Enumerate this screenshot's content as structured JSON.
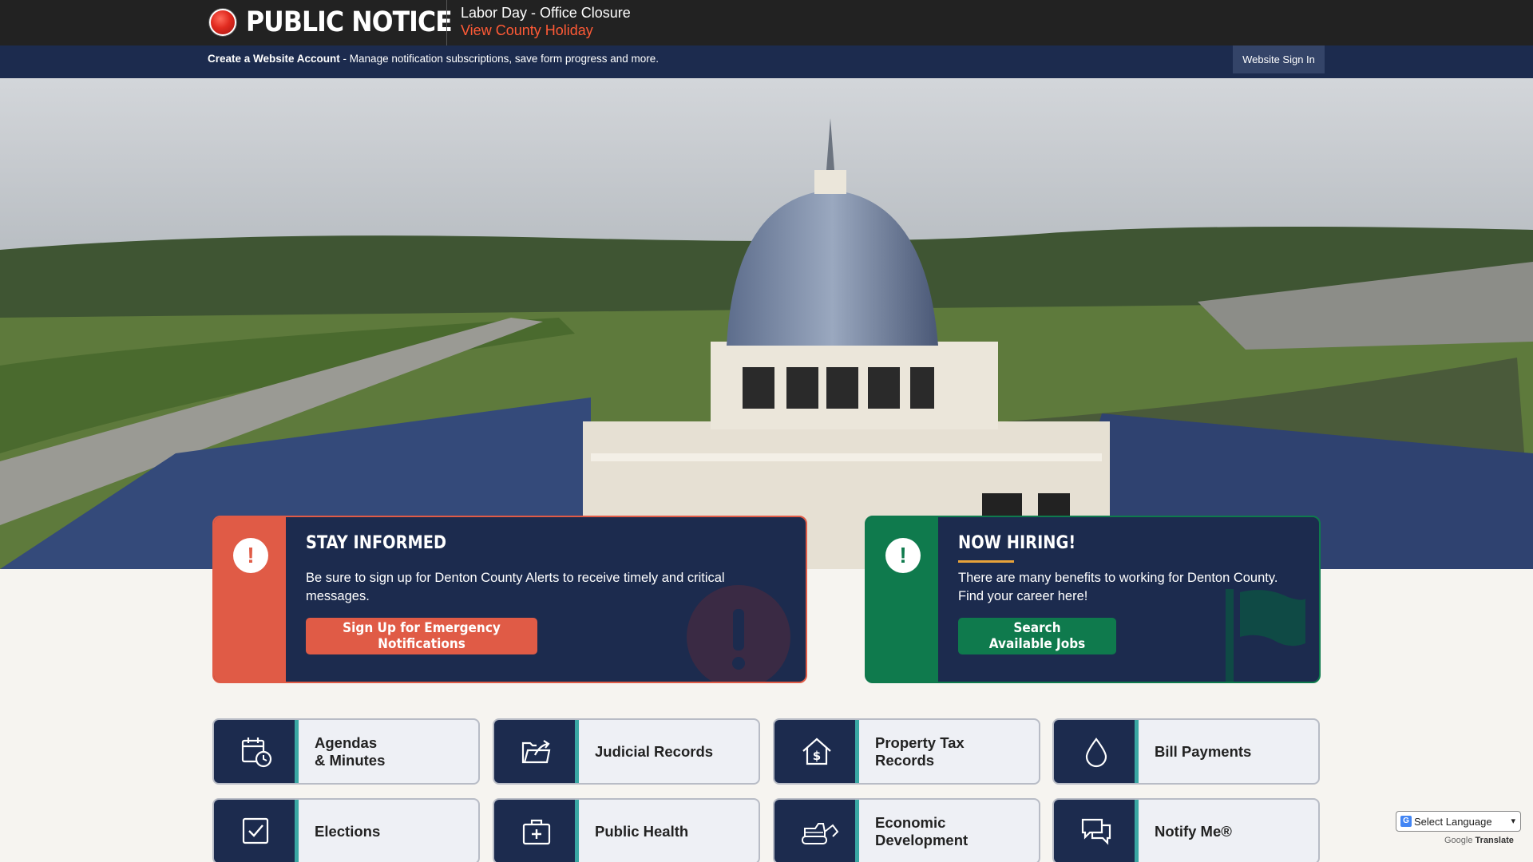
{
  "alert_bar": {
    "heading": "PUBLIC NOTICE",
    "message": "Labor Day - Office Closure",
    "link": "View County Holiday"
  },
  "account_bar": {
    "create_label": "Create a Website Account",
    "create_desc": " - Manage notification subscriptions, save form progress and more.",
    "sign_in": "Website Sign In"
  },
  "cards": [
    {
      "title": "STAY INFORMED",
      "body": "Be sure to sign up for Denton County Alerts to receive timely and critical messages.",
      "button": "Sign Up for Emergency Notifications",
      "icon": "exclamation-icon",
      "color": "#e05b46"
    },
    {
      "title": "NOW HIRING!",
      "body": "There are many benefits to working for Denton County. Find your career here!",
      "button": "Search Available Jobs",
      "icon": "exclamation-icon",
      "color": "#0f7a4d"
    }
  ],
  "tiles": [
    {
      "label": "Agendas\n& Minutes",
      "icon": "calendar-clock-icon"
    },
    {
      "label": "Judicial Records",
      "icon": "folder-arrow-icon"
    },
    {
      "label": "Property Tax\nRecords",
      "icon": "house-dollar-icon"
    },
    {
      "label": "Bill Payments",
      "icon": "water-drop-icon"
    },
    {
      "label": "Elections",
      "icon": "checkbox-icon"
    },
    {
      "label": "Public Health",
      "icon": "medical-kit-icon"
    },
    {
      "label": "Economic\nDevelopment",
      "icon": "bulldozer-icon"
    },
    {
      "label": "Notify Me®",
      "icon": "chat-bubbles-icon"
    }
  ],
  "translate": {
    "select": "Select Language",
    "powered": "Google",
    "translate": "Translate"
  },
  "colors": {
    "navy": "#1c2b4e",
    "accent_red": "#e05b46",
    "accent_green": "#0f7a4d",
    "teal": "#3aa7a3"
  }
}
